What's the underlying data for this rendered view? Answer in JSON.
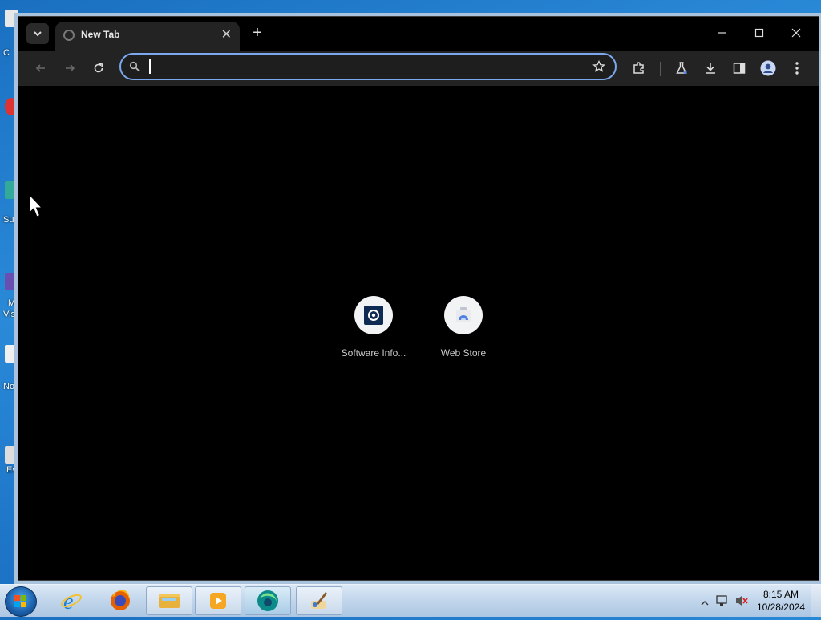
{
  "desktop": {
    "labels": [
      "C",
      "Su",
      "M",
      "Vis",
      "No",
      "Ev"
    ]
  },
  "browser": {
    "tab": {
      "title": "New Tab",
      "favicon": "globe-icon",
      "close_icon": "close-icon"
    },
    "new_tab_icon": "plus-icon",
    "window_controls": [
      "minimize-icon",
      "maximize-icon",
      "close-icon"
    ],
    "toolbar": {
      "back_icon": "arrow-left-icon",
      "forward_icon": "arrow-right-icon",
      "reload_icon": "reload-icon",
      "omnibox": {
        "value": "",
        "placeholder": ""
      },
      "bookmark_icon": "star-icon",
      "right_icons": [
        "puzzle-icon",
        "flask-icon",
        "download-icon",
        "side-panel-icon",
        "profile-icon",
        "kebab-menu-icon"
      ]
    },
    "shortcuts": [
      {
        "label": "Software Info...",
        "icon": "software-info-icon"
      },
      {
        "label": "Web Store",
        "icon": "web-store-icon"
      }
    ]
  },
  "taskbar": {
    "pinned": [
      "internet-explorer-icon",
      "firefox-icon",
      "file-explorer-icon",
      "media-player-icon",
      "browser-icon",
      "paint-brush-icon"
    ],
    "tray_icons": [
      "show-hidden-icons-icon",
      "network-icon",
      "volume-muted-icon"
    ],
    "clock": {
      "time": "8:15 AM",
      "date": "10/28/2024"
    }
  },
  "colors": {
    "window_bg": "#000000",
    "omnibox_border": "#7ca8f0",
    "taskbar": "#c3d7ec"
  }
}
